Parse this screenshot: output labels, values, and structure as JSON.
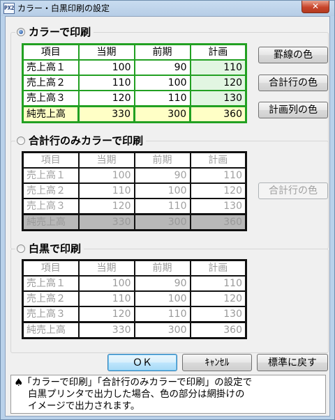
{
  "window": {
    "icon_text": "PX2",
    "title": "カラー・白黒印刷の設定",
    "close_glyph": "✕"
  },
  "columns": [
    "項目",
    "当期",
    "前期",
    "計画"
  ],
  "rows": [
    [
      "売上高１",
      "100",
      "90",
      "110"
    ],
    [
      "売上高２",
      "110",
      "100",
      "120"
    ],
    [
      "売上高３",
      "120",
      "110",
      "130"
    ]
  ],
  "total_row": [
    "純売上高",
    "330",
    "300",
    "360"
  ],
  "options": [
    {
      "label": "カラーで印刷",
      "checked": true
    },
    {
      "label": "合計行のみカラーで印刷",
      "checked": false
    },
    {
      "label": "白黒で印刷",
      "checked": false
    }
  ],
  "color_buttons": {
    "ruled_line": "罫線の色",
    "total_row": "合計行の色",
    "plan_column": "計画列の色",
    "total_row_disabled": "合計行の色"
  },
  "footer": {
    "ok": "ＯＫ",
    "cancel": "ｷｬﾝｾﾙ",
    "reset": "標準に戻す"
  },
  "info": {
    "icon": "♠",
    "lines": [
      "「カラーで印刷」「合計行のみカラーで印刷」の設定で",
      "白黒プリンタで出力した場合、色の部分は網掛けの",
      "イメージで出力されます。"
    ]
  },
  "colors": {
    "grid_line": "#22a022",
    "plan_fill": "#e2f6e2",
    "total_fill": "#ffffc6",
    "total_fill_mono": "#b8b8b8"
  }
}
